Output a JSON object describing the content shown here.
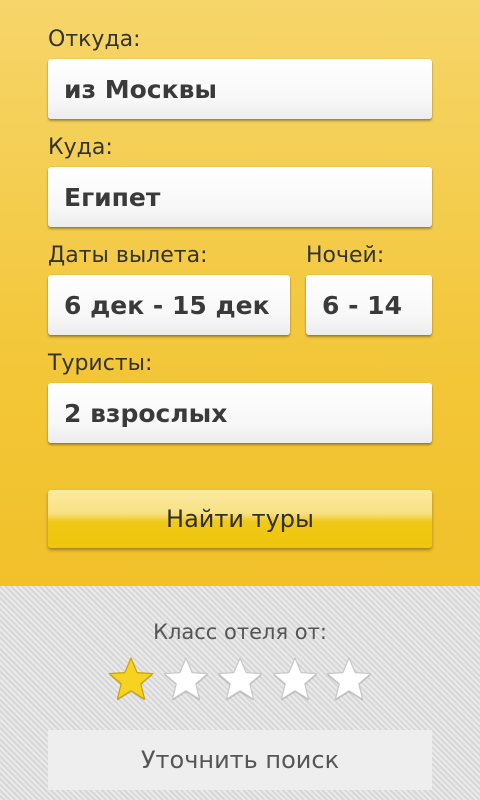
{
  "form": {
    "from_label": "Откуда:",
    "from_value": "из Москвы",
    "to_label": "Куда:",
    "to_value": "Египет",
    "dates_label": "Даты вылета:",
    "dates_value": "6 дек - 15 дек",
    "nights_label": "Ночей:",
    "nights_value": "6 - 14",
    "tourists_label": "Туристы:",
    "tourists_value": "2 взрослых",
    "search_button": "Найти туры"
  },
  "filters": {
    "hotel_class_label": "Класс отеля от:",
    "hotel_class_selected": 1,
    "hotel_class_max": 5,
    "refine_button": "Уточнить поиск"
  },
  "colors": {
    "star_active": "#f7d21e",
    "star_inactive": "#ffffff",
    "accent": "#f2c12a"
  }
}
